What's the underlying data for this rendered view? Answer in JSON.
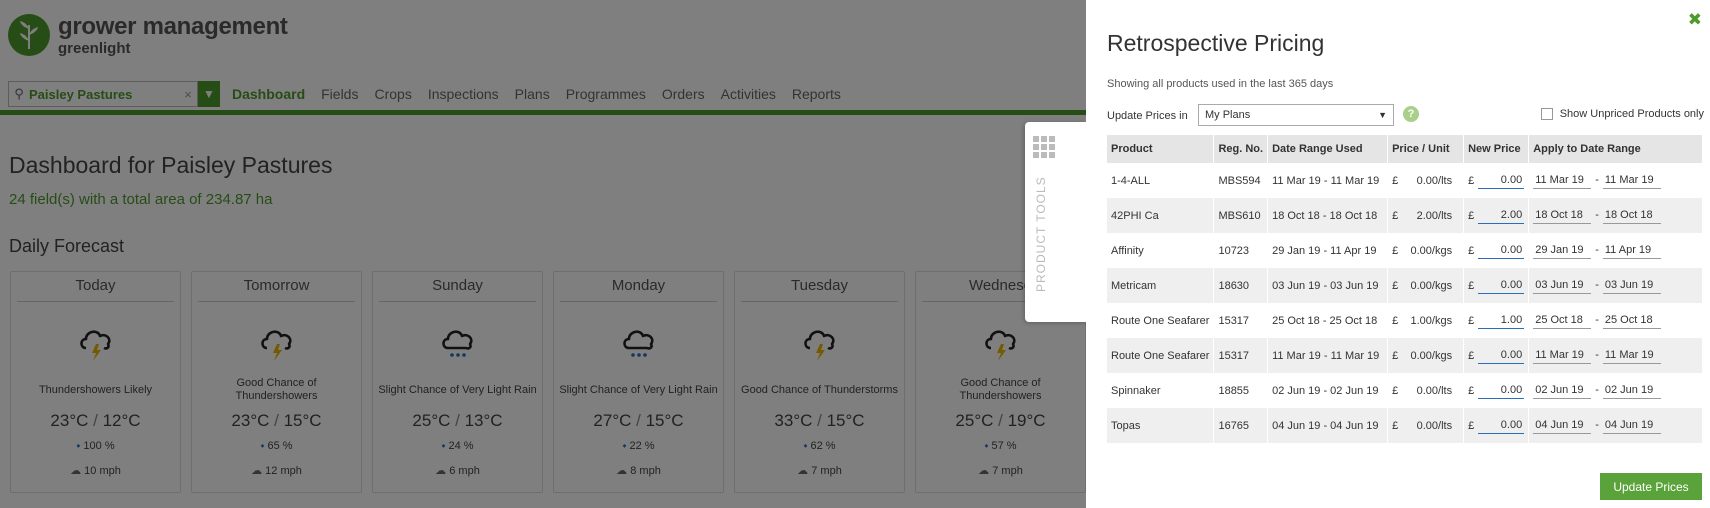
{
  "app": {
    "logo_title": "grower management",
    "logo_sub": "greenlight",
    "search_value": "Paisley Pastures",
    "nav": [
      "Dashboard",
      "Fields",
      "Crops",
      "Inspections",
      "Plans",
      "Programmes",
      "Orders",
      "Activities",
      "Reports"
    ],
    "dashboard_title": "Dashboard for Paisley Pastures",
    "dashboard_sub": "24 field(s) with a total area of 234.87 ha",
    "forecast_title": "Daily Forecast",
    "forecast": [
      {
        "day": "Today",
        "icon": "thunderstorm-icon",
        "desc": "Thundershowers Likely",
        "high": "23°C",
        "low": "12°C",
        "rain": "100 %",
        "wind": "10 mph"
      },
      {
        "day": "Tomorrow",
        "icon": "thunderstorm-icon",
        "desc": "Good Chance of Thundershowers",
        "high": "23°C",
        "low": "15°C",
        "rain": "65 %",
        "wind": "12 mph"
      },
      {
        "day": "Sunday",
        "icon": "rain-cloud-icon",
        "desc": "Slight Chance of Very Light Rain",
        "high": "25°C",
        "low": "13°C",
        "rain": "24 %",
        "wind": "6 mph"
      },
      {
        "day": "Monday",
        "icon": "rain-cloud-icon",
        "desc": "Slight Chance of Very Light Rain",
        "high": "27°C",
        "low": "15°C",
        "rain": "22 %",
        "wind": "8 mph"
      },
      {
        "day": "Tuesday",
        "icon": "thunderstorm-icon",
        "desc": "Good Chance of Thunderstorms",
        "high": "33°C",
        "low": "15°C",
        "rain": "62 %",
        "wind": "7 mph"
      },
      {
        "day": "Wednesd",
        "icon": "thunderstorm-icon",
        "desc": "Good Chance of Thundershowers",
        "high": "25°C",
        "low": "19°C",
        "rain": "57 %",
        "wind": "7 mph"
      }
    ],
    "product_tools_label": "PRODUCT TOOLS"
  },
  "modal": {
    "title": "Retrospective Pricing",
    "subtitle": "Showing all products used in the last 365 days",
    "update_in_label": "Update Prices in",
    "update_in_value": "My Plans",
    "show_unpriced_label": "Show Unpriced Products only",
    "columns": [
      "Product",
      "Reg. No.",
      "Date Range Used",
      "Price / Unit",
      "New Price",
      "Apply to Date Range"
    ],
    "currency": "£",
    "rows": [
      {
        "product": "1-4-ALL",
        "reg": "MBS594",
        "range": "11 Mar 19 - 11 Mar 19",
        "price": "0.00/lts",
        "new_price": "0.00",
        "from": "11 Mar 19",
        "to": "11 Mar 19"
      },
      {
        "product": "42PHI Ca",
        "reg": "MBS610",
        "range": "18 Oct 18 - 18 Oct 18",
        "price": "2.00/lts",
        "new_price": "2.00",
        "from": "18 Oct 18",
        "to": "18 Oct 18"
      },
      {
        "product": "Affinity",
        "reg": "10723",
        "range": "29 Jan 19 - 11 Apr 19",
        "price": "0.00/kgs",
        "new_price": "0.00",
        "from": "29 Jan 19",
        "to": "11 Apr 19"
      },
      {
        "product": "Metricam",
        "reg": "18630",
        "range": "03 Jun 19 - 03 Jun 19",
        "price": "0.00/kgs",
        "new_price": "0.00",
        "from": "03 Jun 19",
        "to": "03 Jun 19"
      },
      {
        "product": "Route One Seafarer",
        "reg": "15317",
        "range": "25 Oct 18 - 25 Oct 18",
        "price": "1.00/kgs",
        "new_price": "1.00",
        "from": "25 Oct 18",
        "to": "25 Oct 18"
      },
      {
        "product": "Route One Seafarer",
        "reg": "15317",
        "range": "11 Mar 19 - 11 Mar 19",
        "price": "0.00/kgs",
        "new_price": "0.00",
        "from": "11 Mar 19",
        "to": "11 Mar 19"
      },
      {
        "product": "Spinnaker",
        "reg": "18855",
        "range": "02 Jun 19 - 02 Jun 19",
        "price": "0.00/lts",
        "new_price": "0.00",
        "from": "02 Jun 19",
        "to": "02 Jun 19"
      },
      {
        "product": "Topas",
        "reg": "16765",
        "range": "04 Jun 19 - 04 Jun 19",
        "price": "0.00/lts",
        "new_price": "0.00",
        "from": "04 Jun 19",
        "to": "04 Jun 19"
      }
    ],
    "update_button": "Update Prices"
  },
  "colors": {
    "brand_green": "#4e9a2e",
    "overlay": "rgba(0,0,0,0.5)",
    "input_underline": "#2a6ebb"
  }
}
